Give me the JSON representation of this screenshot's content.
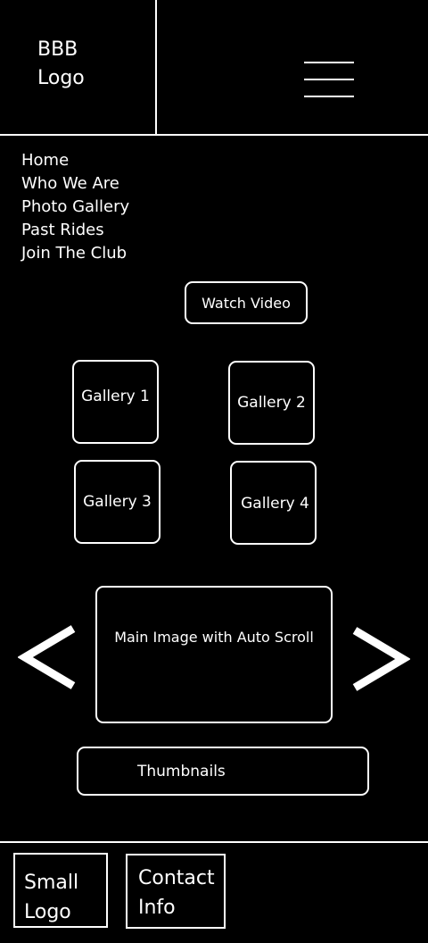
{
  "header": {
    "logo_text": "BBB\nLogo"
  },
  "nav": {
    "items": [
      {
        "label": "Home"
      },
      {
        "label": "Who We Are"
      },
      {
        "label": "Photo Gallery"
      },
      {
        "label": "Past Rides"
      },
      {
        "label": "Join The Club"
      }
    ]
  },
  "hero": {
    "watch_video_label": "Watch Video"
  },
  "galleries": [
    {
      "label": "Gallery 1"
    },
    {
      "label": "Gallery 2"
    },
    {
      "label": "Gallery 3"
    },
    {
      "label": "Gallery 4"
    }
  ],
  "carousel": {
    "main_image_label": "Main Image with Auto Scroll",
    "thumbnails_label": "Thumbnails",
    "prev_icon": "chevron-left-icon",
    "next_icon": "chevron-right-icon"
  },
  "footer": {
    "small_logo_text": "Small\nLogo",
    "contact_text": "Contact\nInfo"
  },
  "colors": {
    "background": "#000000",
    "foreground": "#ffffff"
  }
}
